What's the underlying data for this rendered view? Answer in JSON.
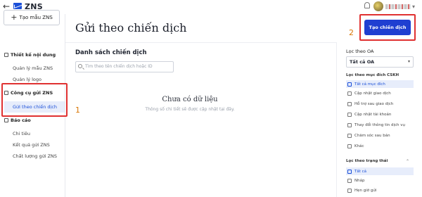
{
  "app": {
    "name": "ZNS",
    "back_icon": "back-arrow-icon"
  },
  "sidebar": {
    "create_template_label": "Tạo mẫu ZNS",
    "sections": [
      {
        "label": "Thiết kế nội dung",
        "items": [
          "Quản lý mẫu ZNS",
          "Quản lý logo"
        ]
      },
      {
        "label": "Công cụ gửi ZNS",
        "items": [
          "Gửi theo chiến dịch"
        ]
      },
      {
        "label": "Báo cáo",
        "items": [
          "Chi tiêu",
          "Kết quả gửi ZNS",
          "Chất lượng gửi ZNS"
        ]
      }
    ]
  },
  "annotations": {
    "marker1": "1",
    "marker2": "2",
    "highlight_color": "#e03131",
    "marker_color": "#d97706"
  },
  "main": {
    "title": "Gửi theo chiến dịch",
    "list_title": "Danh sách chiến dịch",
    "search_placeholder": "Tìm theo tên chiến dịch hoặc ID",
    "empty_title": "Chưa có dữ liệu",
    "empty_subtitle": "Thông số chi tiết sẽ được cập nhật tại đây."
  },
  "header": {
    "create_campaign_label": "Tạo chiến dịch",
    "accent": "#1f3fd1"
  },
  "filters": {
    "oa_label": "Lọc theo OA",
    "oa_value": "Tất cả OA",
    "purpose_label": "Lọc theo mục đích CSKH",
    "purpose_items": [
      "Tất cả mục đích",
      "Cập nhật giao dịch",
      "Hỗ trợ sau giao dịch",
      "Cập nhật tài khoản",
      "Thay đổi thông tin dịch vụ",
      "Chăm sóc sau bán",
      "Khác"
    ],
    "status_label": "Lọc theo trạng thái",
    "status_items": [
      "Tất cả",
      "Nháp",
      "Hẹn giờ gửi"
    ]
  }
}
